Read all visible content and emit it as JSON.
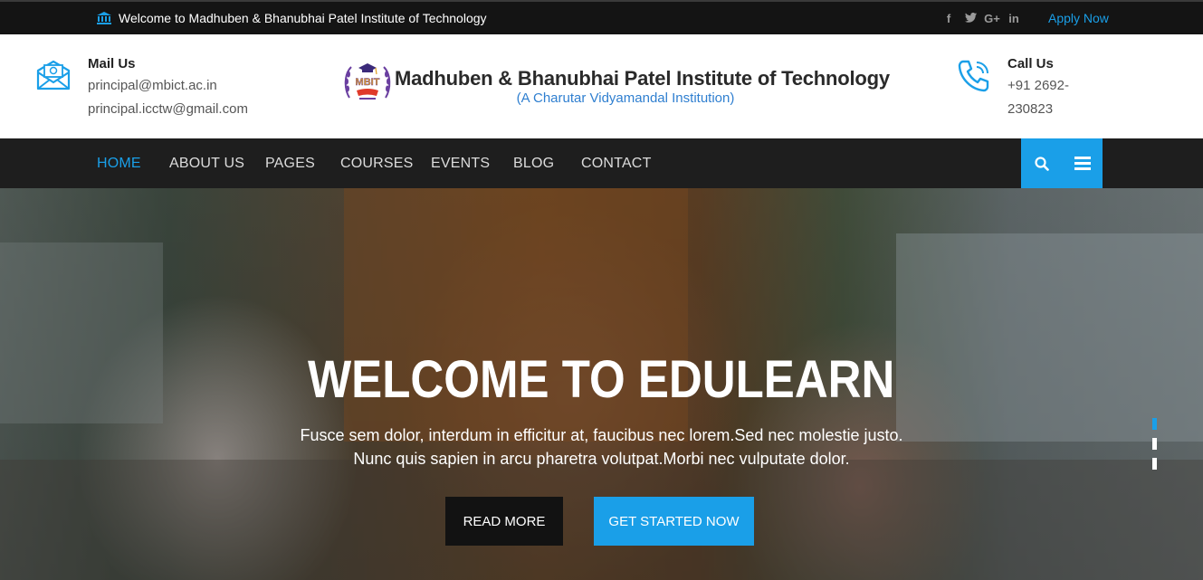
{
  "topbar": {
    "welcome_text": "Welcome to Madhuben & Bhanubhai Patel Institute of Technology",
    "social": [
      "f",
      "t",
      "G+",
      "in"
    ],
    "apply_label": "Apply Now"
  },
  "header": {
    "mail": {
      "title": "Mail Us",
      "emails": [
        "principal@mbict.ac.in",
        "principal.icctw@gmail.com"
      ]
    },
    "institute": {
      "name": "Madhuben & Bhanubhai Patel Institute of Technology",
      "subtitle": "(A Charutar Vidyamandal Institution)",
      "logo_text": "MBIT"
    },
    "call": {
      "title": "Call Us",
      "phone_lines": [
        "+91 2692-",
        "230823"
      ]
    }
  },
  "nav": {
    "items": [
      {
        "label": "HOME",
        "active": true
      },
      {
        "label": "ABOUT US",
        "active": false
      },
      {
        "label": "PAGES",
        "active": false
      },
      {
        "label": "COURSES",
        "active": false
      },
      {
        "label": "EVENTS",
        "active": false
      },
      {
        "label": "BLOG",
        "active": false
      },
      {
        "label": "CONTACT",
        "active": false
      }
    ],
    "tools": [
      "search-icon",
      "menu-icon"
    ]
  },
  "hero": {
    "heading": "WELCOME TO EDULEARN",
    "subtext_lines": [
      "Fusce sem dolor, interdum in efficitur at, faucibus nec lorem.Sed nec molestie justo.",
      "Nunc quis sapien in arcu pharetra volutpat.Morbi nec vulputate dolor."
    ],
    "read_more_label": "READ MORE",
    "get_started_label": "GET STARTED NOW",
    "slides_count": 3,
    "active_slide": 1
  },
  "colors": {
    "accent": "#1a9fe8",
    "topbar_bg": "#141414",
    "nav_bg": "#1e1e1e"
  }
}
